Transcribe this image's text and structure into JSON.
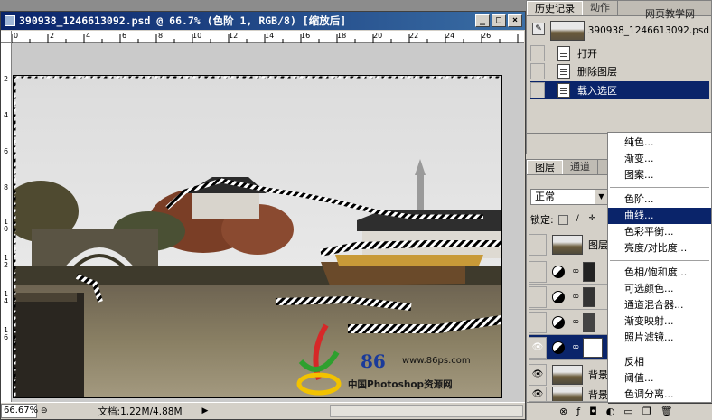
{
  "document": {
    "title": "390938_1246613092.psd @ 66.7% (色阶 1, RGB/8) [缩放后]",
    "min_btn": "_",
    "max_btn": "□",
    "close_btn": "×",
    "zoom": "66.67%",
    "doc_info": "文档:1.22M/4.88M",
    "ruler_top": [
      "0",
      "2",
      "4",
      "6",
      "8",
      "10",
      "12",
      "14",
      "16",
      "18",
      "20",
      "22",
      "24",
      "26"
    ],
    "ruler_left": [
      "2",
      "4",
      "6",
      "8",
      "1\n0",
      "1\n2",
      "1\n4",
      "1\n6"
    ],
    "watermark_url": "www.86ps.com",
    "watermark_logo": "86",
    "watermark_cn": "中国Photoshop资源网"
  },
  "history": {
    "tabs": [
      "历史记录",
      "动作"
    ],
    "site_watermark": "网页教学网",
    "snapshot_name": "390938_1246613092.psd",
    "items": [
      {
        "label": "打开",
        "active": false
      },
      {
        "label": "删除图层",
        "active": false
      },
      {
        "label": "载入选区",
        "active": true
      }
    ]
  },
  "layers": {
    "tabs": [
      "图层",
      "通道"
    ],
    "blend_mode": "正常",
    "lock_label": "锁定:",
    "rows": [
      {
        "name": "图层",
        "eye": false,
        "active": false
      },
      {
        "name": "",
        "eye": false,
        "active": false
      },
      {
        "name": "",
        "eye": false,
        "active": false
      },
      {
        "name": "",
        "eye": false,
        "active": false
      },
      {
        "name": "",
        "eye": true,
        "active": true
      },
      {
        "name": "背景",
        "eye": true,
        "active": false
      },
      {
        "name": "背景",
        "eye": true,
        "active": false
      }
    ]
  },
  "adjust_menu": {
    "groups": [
      [
        "纯色...",
        "渐变...",
        "图案..."
      ],
      [
        "色阶...",
        "曲线...",
        "色彩平衡...",
        "亮度/对比度..."
      ],
      [
        "色相/饱和度...",
        "可选颜色...",
        "通道混合器...",
        "渐变映射...",
        "照片滤镜..."
      ],
      [
        "反相",
        "阈值...",
        "色调分离..."
      ]
    ],
    "selected": "曲线..."
  }
}
